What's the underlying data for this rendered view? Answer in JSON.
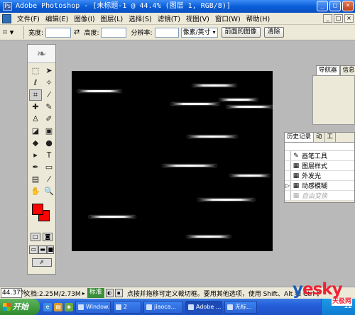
{
  "window": {
    "title": "Adobe Photoshop - [未标题-1 @ 44.4% (图层 1, RGB/8)]",
    "app_icon": "Ps",
    "buttons": [
      "_",
      "□",
      "×"
    ]
  },
  "menu": {
    "items": [
      "文件(F)",
      "编辑(E)",
      "图像(I)",
      "图层(L)",
      "选择(S)",
      "滤镜(T)",
      "视图(V)",
      "窗口(W)",
      "帮助(H)"
    ],
    "mdi_buttons": [
      "_",
      "□",
      "×"
    ]
  },
  "options": {
    "width_label": "宽度:",
    "height_label": "高度:",
    "resolution_label": "分辨率:",
    "unit_value": "像素/英寸",
    "front_image_button": "前面的图像",
    "clear_button": "清除"
  },
  "canvas": {
    "background": "#000000",
    "streaks_icon_note": "motion-blur light streaks"
  },
  "navigator": {
    "tabs": [
      "导航器",
      "信息"
    ]
  },
  "history": {
    "tabs": [
      "历史记录",
      "动",
      "工"
    ],
    "rows": [
      {
        "label": "画笔工具",
        "icon": "brush-icon",
        "state": "normal"
      },
      {
        "label": "图层样式",
        "icon": "layer-style-icon",
        "state": "normal"
      },
      {
        "label": "外发光",
        "icon": "outer-glow-icon",
        "state": "normal"
      },
      {
        "label": "动感模糊",
        "icon": "motion-blur-icon",
        "state": "current"
      },
      {
        "label": "自由变换",
        "icon": "free-transform-icon",
        "state": "dim"
      }
    ]
  },
  "status": {
    "zoom": "44.37%",
    "doc_size": "文档:2.25M/2.73M",
    "mode_badge": "标准",
    "hint": "点按并拖移可定义裁切框。要用其他选项，使用 Shift、Alt 和 Ctrl 键。"
  },
  "taskbar": {
    "start_label": "开始",
    "tasks": [
      {
        "label": "Window...",
        "active": false
      },
      {
        "label": "2",
        "active": false
      },
      {
        "label": "jiaoca...",
        "active": false
      },
      {
        "label": "Adobe ...",
        "active": true
      },
      {
        "label": "无标...",
        "active": false
      }
    ],
    "clock": "12"
  },
  "watermark": {
    "text": "yesky",
    "subtext": "天极网"
  },
  "colors": {
    "foreground": "#ff0000",
    "background": "#ff0000",
    "titlebar": "#0a5fd9"
  }
}
